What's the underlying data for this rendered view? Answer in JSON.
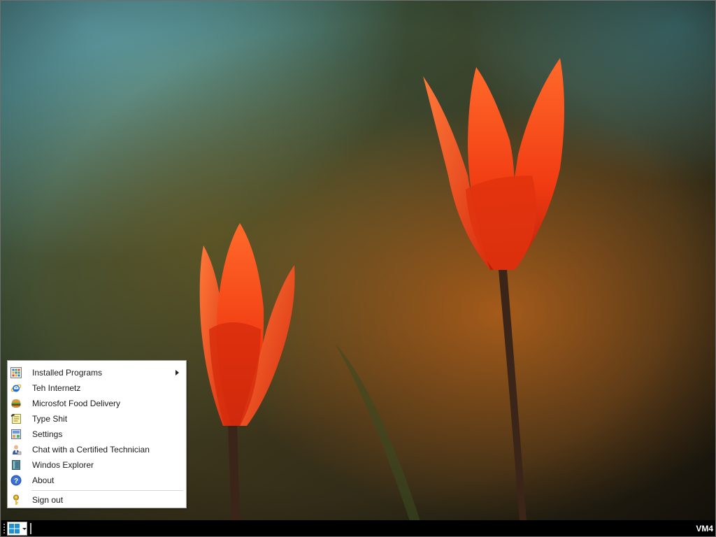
{
  "colors": {
    "taskbar": "#000000",
    "menu_background": "#ffffff",
    "menu_border": "#a8a8a8",
    "start_logo": "#1e90d8",
    "tulip": "#ff4a1a"
  },
  "desktop": {
    "wallpaper": "orange-tulips-photo"
  },
  "start_menu": {
    "items": [
      {
        "label": "Installed Programs",
        "icon": "installed-programs-icon",
        "has_submenu": true
      },
      {
        "label": "Teh Internetz",
        "icon": "internet-explorer-icon"
      },
      {
        "label": "Microsfot Food Delivery",
        "icon": "burger-icon"
      },
      {
        "label": "Type Shit",
        "icon": "notepad-icon"
      },
      {
        "label": "Settings",
        "icon": "control-panel-icon"
      },
      {
        "label": "Chat with a Certified Technician",
        "icon": "technician-icon"
      },
      {
        "label": "Windos Explorer",
        "icon": "explorer-book-icon"
      },
      {
        "label": "About",
        "icon": "help-icon"
      }
    ],
    "sign_out": {
      "label": "Sign out",
      "icon": "key-icon"
    }
  },
  "taskbar": {
    "start_icon": "windows-logo-icon",
    "machine_label": "VM4"
  }
}
